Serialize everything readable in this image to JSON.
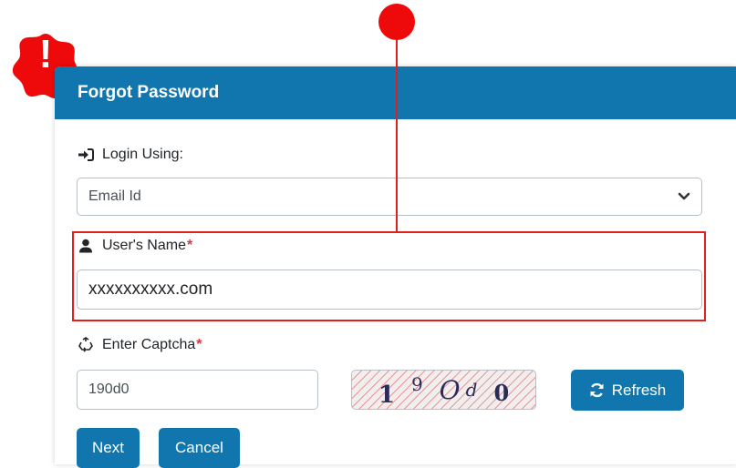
{
  "dialog": {
    "title": "Forgot Password"
  },
  "login_using": {
    "label": "Login Using:",
    "selected": "Email Id",
    "icon": "sign-in-icon"
  },
  "username": {
    "label": "User's Name",
    "required_mark": "*",
    "value": "xxxxxxxxxx.com",
    "icon": "user-icon"
  },
  "captcha": {
    "label": "Enter Captcha",
    "required_mark": "*",
    "input_value": "190d0",
    "image_chars": [
      "1",
      "9",
      "O",
      "d",
      "0"
    ],
    "icon": "recycle-icon",
    "refresh_label": "Refresh",
    "refresh_icon": "sync-icon"
  },
  "actions": {
    "next_label": "Next",
    "cancel_label": "Cancel"
  },
  "annotations": {
    "alert_mark": "!",
    "alert_color": "#ee0a0a",
    "highlight_color": "#e02020"
  },
  "colors": {
    "primary": "#1076ad",
    "required": "#dc3545"
  }
}
